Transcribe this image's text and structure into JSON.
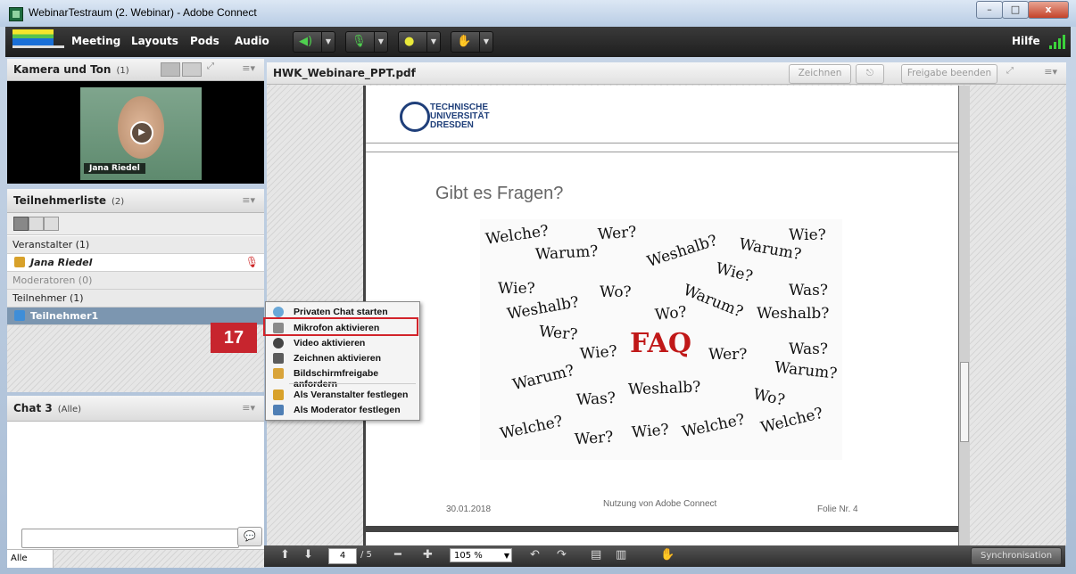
{
  "window": {
    "title": "WebinarTestraum (2. Webinar) - Adobe Connect",
    "min": "–",
    "max": "□",
    "close": "x"
  },
  "menubar": {
    "items": [
      "Meeting",
      "Layouts",
      "Pods",
      "Audio"
    ],
    "help": "Hilfe"
  },
  "camera_pod": {
    "title": "Kamera und Ton",
    "count": "(1)",
    "video_name": "Jana Riedel"
  },
  "attendee_pod": {
    "title": "Teilnehmerliste",
    "count": "(2)",
    "groups": {
      "hosts": "Veranstalter (1)",
      "host_name": "Jana Riedel",
      "presenters": "Moderatoren (0)",
      "participants": "Teilnehmer (1)",
      "participant_name": "Teilnehmer1"
    }
  },
  "chat_pod": {
    "title": "Chat 3",
    "scope": "(Alle)",
    "recipient": "Alle",
    "input_placeholder": ""
  },
  "share_pod": {
    "title": "HWK_Webinare_PPT.pdf",
    "draw_button": "Zeichnen",
    "stop_share_button": "Freigabe beenden"
  },
  "slide": {
    "university_line1": "TECHNISCHE",
    "university_line2": "UNIVERSITÄT",
    "university_line3": "DRESDEN",
    "heading": "Gibt es Fragen?",
    "footer_date": "30.01.2018",
    "footer_title": "Nutzung von Adobe Connect",
    "footer_page": "Folie Nr. 4",
    "image_words": {
      "w1": "Welche?",
      "w2": "Wer?",
      "w3": "Wie?",
      "w4": "Warum?",
      "w5": "Weshalb?",
      "w6": "Warum?",
      "w7": "Wie?",
      "w8": "Wie?",
      "w9": "Wo?",
      "w10": "Was?",
      "w11": "Weshalb?",
      "w12": "Warum?",
      "w13": "Wo?",
      "w14": "Weshalb?",
      "w15": "Wer?",
      "w16": "Wie?",
      "w17": "FAQ",
      "w18": "Wer?",
      "w19": "Was?",
      "w20": "Warum?",
      "w21": "Warum?",
      "w22": "Was?",
      "w23": "Weshalb?",
      "w24": "Wo?",
      "w25": "Welche?",
      "w26": "Wer?",
      "w27": "Wie?",
      "w28": "Welche?",
      "w29": "Welche?"
    }
  },
  "context_menu": {
    "items": [
      {
        "label": "Privaten Chat starten",
        "icon": "chat-icon"
      },
      {
        "label": "Mikrofon aktivieren",
        "icon": "microphone-icon"
      },
      {
        "label": "Video aktivieren",
        "icon": "webcam-icon"
      },
      {
        "label": "Zeichnen aktivieren",
        "icon": "draw-icon"
      },
      {
        "label": "Bildschirmfreigabe anfordern",
        "icon": "screen-share-icon"
      },
      {
        "label": "Als Veranstalter festlegen",
        "icon": "host-icon"
      },
      {
        "label": "Als Moderator festlegen",
        "icon": "presenter-icon"
      }
    ]
  },
  "annotation": {
    "step": "17"
  },
  "bottombar": {
    "page_current": "4",
    "page_total": "/ 5",
    "zoom": "105 %",
    "sync_button": "Synchronisation"
  },
  "colors": {
    "accent_red": "#d2232a",
    "mic_green": "#4fd04f",
    "menubar": "#2a2a2a"
  }
}
